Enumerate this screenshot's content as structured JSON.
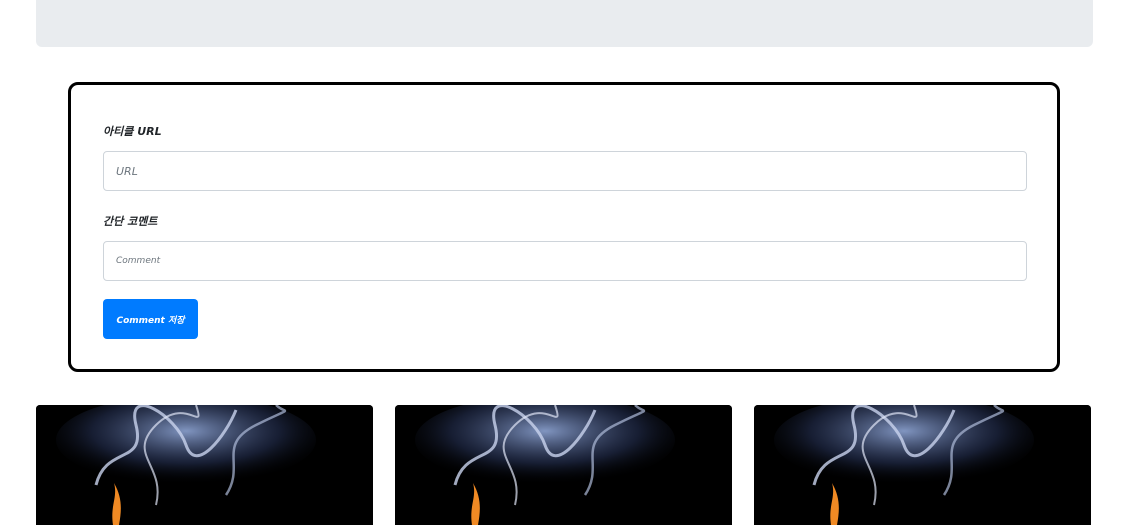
{
  "form": {
    "url_label": "아티클 URL",
    "url_placeholder": "URL",
    "comment_label": "간단 코멘트",
    "comment_placeholder": "Comment",
    "submit_label": "Comment 저장"
  },
  "cards": [
    {
      "image": "smoke-flame-image"
    },
    {
      "image": "smoke-flame-image"
    },
    {
      "image": "smoke-flame-image"
    }
  ],
  "colors": {
    "primary": "#007bff",
    "jumbotron": "#e9ecef",
    "border": "#000000"
  }
}
